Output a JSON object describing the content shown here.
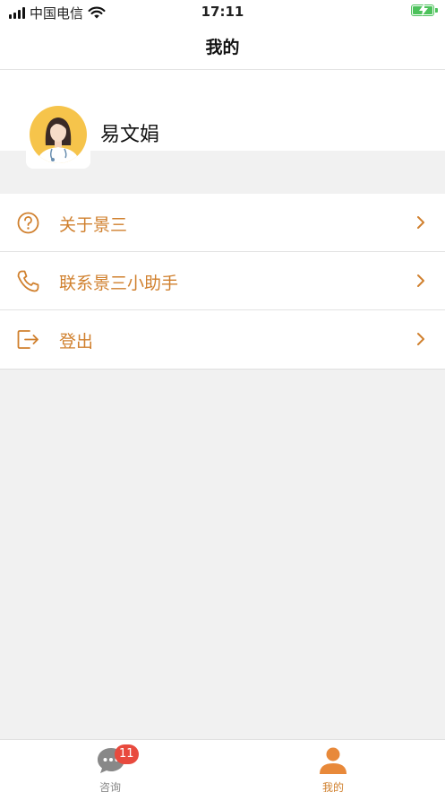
{
  "status_bar": {
    "carrier": "中国电信",
    "time": "17:11"
  },
  "nav": {
    "title": "我的"
  },
  "profile": {
    "name": "易文娟"
  },
  "menu": {
    "items": [
      {
        "label": "关于景三",
        "icon": "question-circle-icon"
      },
      {
        "label": "联系景三小助手",
        "icon": "phone-icon"
      },
      {
        "label": "登出",
        "icon": "logout-icon"
      }
    ]
  },
  "tabs": {
    "consult": {
      "label": "咨询",
      "badge": "11",
      "icon": "chat-bubble-icon"
    },
    "mine": {
      "label": "我的",
      "icon": "person-icon"
    }
  },
  "colors": {
    "accent": "#d0802e",
    "tab_active": "#e8893a",
    "badge": "#e84a3e",
    "battery": "#4cc25b"
  }
}
